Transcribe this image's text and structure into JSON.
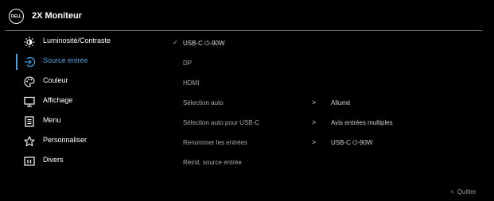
{
  "header": {
    "logo_text": "DELL",
    "title": "2X Moniteur"
  },
  "sidebar": {
    "items": [
      {
        "label": "Luminosité/Contraste",
        "icon": "brightness-icon"
      },
      {
        "label": "Source entrée",
        "icon": "input-source-icon",
        "active": true
      },
      {
        "label": "Couleur",
        "icon": "color-palette-icon"
      },
      {
        "label": "Affichage",
        "icon": "display-icon"
      },
      {
        "label": "Menu",
        "icon": "menu-icon"
      },
      {
        "label": "Personnaliser",
        "icon": "star-icon"
      },
      {
        "label": "Divers",
        "icon": "info-icon"
      }
    ]
  },
  "content": {
    "sources": [
      {
        "label": "USB-C ⏻-90W",
        "selected": true
      },
      {
        "label": "DP"
      },
      {
        "label": "HDMI"
      }
    ],
    "settings": [
      {
        "label": "Sélection auto",
        "value": "Allumé"
      },
      {
        "label": "Sélection auto pour USB-C",
        "value": "Avis entrées multiples"
      },
      {
        "label": "Renommer les entrées",
        "value": "USB-C ⏻-90W"
      },
      {
        "label": "Réinit. source entrée"
      }
    ]
  },
  "footer": {
    "quit_label": "Quitter",
    "quit_icon": "<"
  },
  "colors": {
    "accent": "#4aa3df",
    "background": "#000000",
    "text": "#ffffff",
    "muted": "#a7a7a7"
  }
}
